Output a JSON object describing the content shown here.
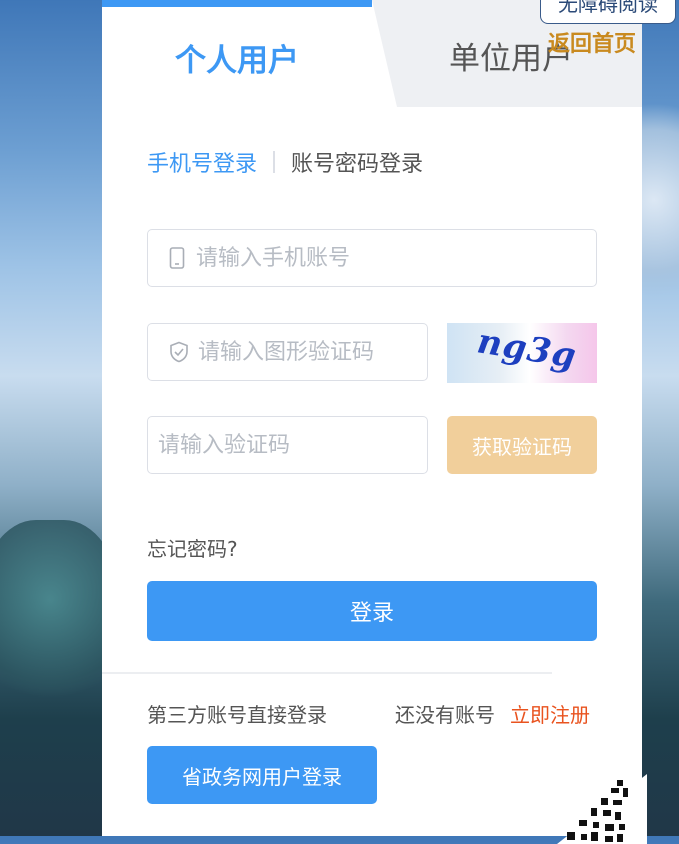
{
  "tabs": {
    "personal": "个人用户",
    "unit": "单位用户"
  },
  "login_modes": {
    "phone": "手机号登录",
    "account": "账号密码登录"
  },
  "form": {
    "phone_placeholder": "请输入手机账号",
    "captcha_placeholder": "请输入图形验证码",
    "code_placeholder": "请输入验证码",
    "captcha_text": "ng3g",
    "get_code_label": "获取验证码",
    "forgot_label": "忘记密码?",
    "login_label": "登录"
  },
  "footer": {
    "third_party_label": "第三方账号直接登录",
    "no_account_label": "还没有账号",
    "register_label": "立即注册",
    "gov_login_label": "省政务网用户登录"
  },
  "top_links": {
    "accessible_reading": "无障碍阅读",
    "back_home": "返回首页"
  },
  "colors": {
    "primary": "#3d98f4",
    "get_code_bg": "#f1cf9b",
    "register": "#e9531f",
    "back_home": "#c98a1f"
  },
  "icons": {
    "phone": "mobile-phone-icon",
    "captcha": "shield-check-icon"
  }
}
